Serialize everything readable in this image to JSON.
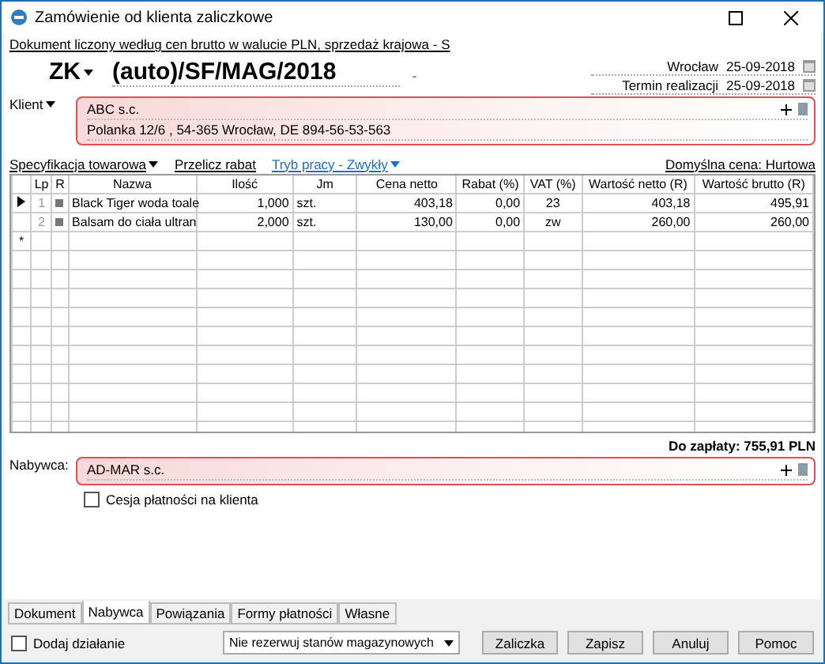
{
  "window": {
    "title": "Zamówienie od klienta zaliczkowe"
  },
  "info_link": "Dokument liczony według cen brutto w walucie PLN, sprzedaż krajowa - S",
  "document": {
    "type": "ZK",
    "number": "(auto)/SF/MAG/2018",
    "separator": "-"
  },
  "dates": [
    {
      "label": "Wrocław",
      "value": "25-09-2018"
    },
    {
      "label": "Termin realizacji",
      "value": "25-09-2018"
    }
  ],
  "client": {
    "label": "Klient",
    "name": "ABC s.c.",
    "address": "Polanka  12/6 , 54-365 Wrocław, DE 894-56-53-563"
  },
  "toolbar": {
    "spec": "Specyfikacja towarowa",
    "recalc": "Przelicz rabat",
    "mode": "Tryb pracy - Zwykły",
    "price": "Domyślna cena: Hurtowa"
  },
  "table": {
    "columns": [
      "Lp",
      "R",
      "Nazwa",
      "Ilość",
      "Jm",
      "Cena netto",
      "Rabat (%)",
      "VAT (%)",
      "Wartość netto (R)",
      "Wartość brutto (R)"
    ],
    "rows": [
      {
        "selected": true,
        "cells": [
          "1",
          "",
          "Black Tiger woda toale",
          "1,000",
          "szt.",
          "403,18",
          "0,00",
          "23",
          "403,18",
          "495,91"
        ]
      },
      {
        "selected": false,
        "cells": [
          "2",
          "",
          "Balsam do ciała ultran",
          "2,000",
          "szt.",
          "130,00",
          "0,00",
          "zw",
          "260,00",
          "260,00"
        ]
      }
    ],
    "new_row_marker": "*"
  },
  "total": "Do zapłaty: 755,91 PLN",
  "buyer": {
    "label": "Nabywca:",
    "name": "AD-MAR s.c."
  },
  "cession": {
    "label": "Cesja płatności na klienta",
    "checked": false
  },
  "tabs": [
    {
      "label": "Dokument",
      "selected": false
    },
    {
      "label": "Nabywca",
      "selected": true
    },
    {
      "label": "Powiązania",
      "selected": false
    },
    {
      "label": "Formy płatności",
      "selected": false
    },
    {
      "label": "Własne",
      "selected": false
    }
  ],
  "add_action": {
    "label": "Dodaj działanie",
    "checked": false
  },
  "reservation": "Nie rezerwuj stanów magazynowych",
  "buttons": [
    "Zaliczka",
    "Zapisz",
    "Anuluj",
    "Pomoc"
  ]
}
